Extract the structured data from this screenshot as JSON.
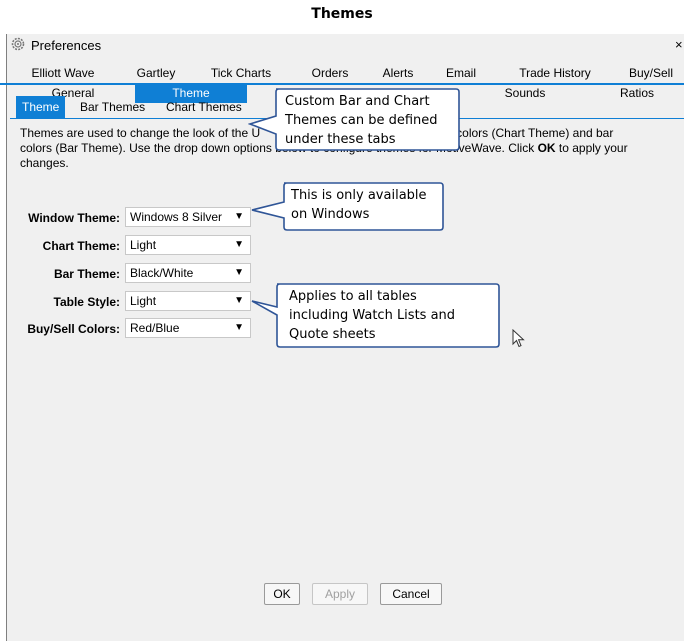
{
  "doc_title": "Themes",
  "window": {
    "title": "Preferences",
    "close": "×"
  },
  "tabs_row1": [
    "Elliott Wave",
    "Gartley",
    "Tick Charts",
    "Orders",
    "Alerts",
    "Email",
    "Trade History",
    "Buy/Sell"
  ],
  "tabs_row2": [
    "General",
    "Theme",
    "Sounds",
    "Ratios"
  ],
  "active_tab": "Theme",
  "subtabs": [
    "Theme",
    "Bar Themes",
    "Chart Themes"
  ],
  "description": {
    "line1_a": "Themes are used to change the look of the U",
    "line1_b": "hart colors (Chart Theme) and bar",
    "line2_a": "colors (Bar Theme). Use the drop down options ",
    "line2_b": "below to configure themes for MotiveWave. Click ",
    "ok": "OK",
    "line2_c": " to apply your",
    "line3": "changes."
  },
  "settings": [
    {
      "label": "Window Theme:",
      "value": "Windows 8 Silver"
    },
    {
      "label": "Chart Theme:",
      "value": "Light"
    },
    {
      "label": "Bar Theme:",
      "value": "Black/White"
    },
    {
      "label": "Table Style:",
      "value": "Light"
    },
    {
      "label": "Buy/Sell Colors:",
      "value": "Red/Blue"
    }
  ],
  "buttons": {
    "ok": "OK",
    "apply": "Apply",
    "cancel": "Cancel"
  },
  "callouts": {
    "tabs": [
      "Custom Bar and Chart",
      "Themes can be defined",
      "under these tabs"
    ],
    "windows": [
      "This is only available",
      "on Windows"
    ],
    "tables": [
      "Applies to all tables",
      "including Watch Lists and",
      "Quote sheets"
    ]
  },
  "colors": {
    "accent": "#0f7fd5",
    "callout_border": "#2f5597",
    "window_bg": "#f0f0f0"
  },
  "icons": {
    "window": "gear-icon",
    "dropdown": "triangle-down-icon",
    "pointer": "mouse-cursor-icon"
  }
}
